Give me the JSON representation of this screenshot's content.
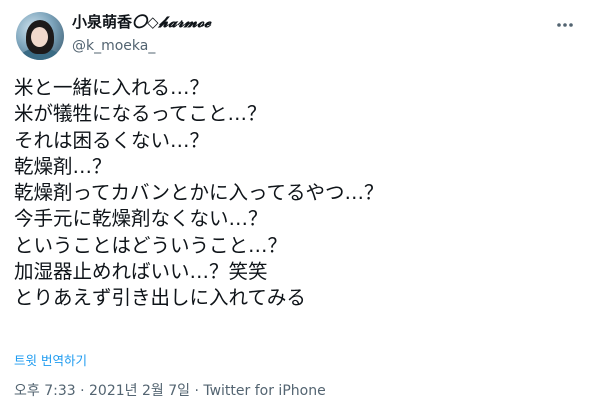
{
  "author": {
    "display_name_main": "小泉萌香",
    "display_name_deco": "〇◇𝓱𝓪𝓻𝓶𝓸𝓮",
    "handle": "@k_moeka_"
  },
  "tweet": {
    "lines": [
      "米と一緒に入れる…？",
      "米が犠牲になるってこと…？",
      "それは困るくない…？",
      "乾燥剤…？",
      "乾燥剤ってカバンとかに入ってるやつ…？",
      "今手元に乾燥剤なくない…？",
      "ということはどういうこと…？",
      "加湿器止めればいい…？笑笑",
      "とりあえず引き出しに入れてみる"
    ],
    "translate_label": "트윗 번역하기",
    "time": "오후 7:33",
    "separator": "·",
    "date": "2021년 2월 7일",
    "source": "Twitter for iPhone"
  },
  "icons": {
    "more": "more-options-icon",
    "avatar": "avatar-photo"
  },
  "colors": {
    "text": "#0f1419",
    "secondary": "#536471",
    "link": "#1d9bf0"
  }
}
